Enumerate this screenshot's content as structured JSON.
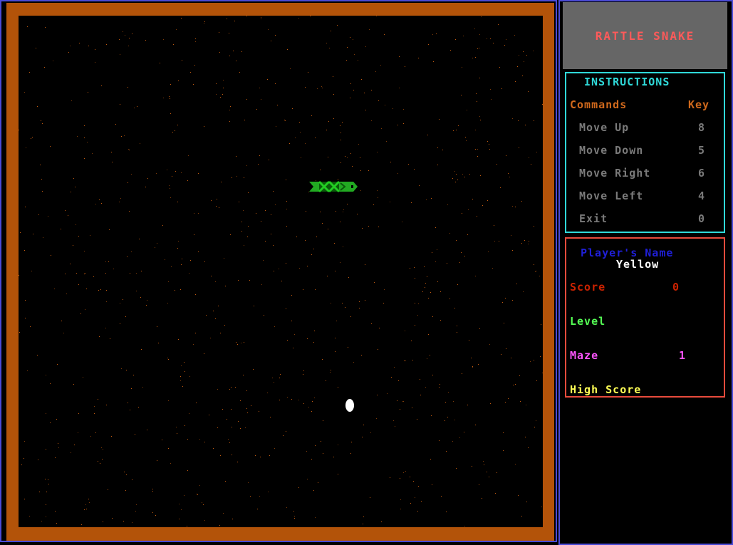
{
  "game": {
    "title": "RATTLE SNAKE"
  },
  "instructions": {
    "heading": "INSTRUCTIONS",
    "commands_header": "Commands",
    "key_header": "Key",
    "commands": [
      {
        "label": "Move Up",
        "key": "8"
      },
      {
        "label": "Move Down",
        "key": "5"
      },
      {
        "label": "Move Right",
        "key": "6"
      },
      {
        "label": "Move Left",
        "key": "4"
      },
      {
        "label": "Exit",
        "key": "0"
      }
    ]
  },
  "player": {
    "name_label": "Player's Name",
    "name": "Yellow",
    "score_label": "Score",
    "score": "0",
    "level_label": "Level",
    "level": "",
    "maze_label": "Maze",
    "maze": "1",
    "high_score_label": "High Score",
    "high_score": ""
  },
  "colors": {
    "wall": "#b35309",
    "frame": "#4b4bd6",
    "title_bg": "#666666",
    "title_text": "#ff5a5a",
    "instructions_border": "#2fd9d9",
    "instructions_heading": "#2fd9d9",
    "commands_header": "#d0691c",
    "command_text": "#7a7a7a",
    "player_border": "#e84b3c",
    "player_name_label": "#1f1fd6",
    "player_name": "#ffffff",
    "score": "#cc2200",
    "level": "#55ff55",
    "maze": "#ff55ff",
    "high_score": "#ffff55",
    "snake": "#22aa22",
    "egg": "#ffffff"
  }
}
